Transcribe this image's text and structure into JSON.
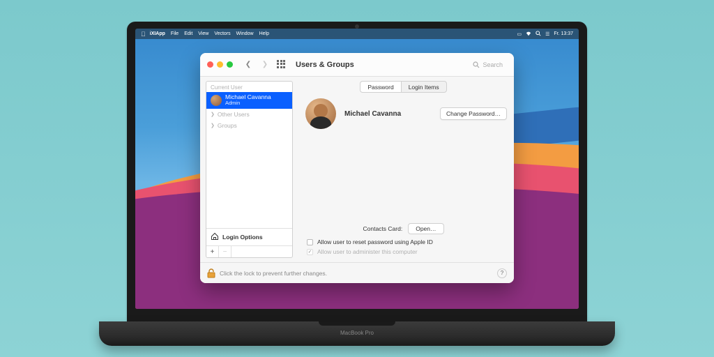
{
  "menubar": {
    "app": "iXIApp",
    "items": [
      "File",
      "Edit",
      "View",
      "Vectors",
      "Window",
      "Help"
    ],
    "clock": "Fr. 13:37"
  },
  "window": {
    "title": "Users & Groups",
    "search_placeholder": "Search",
    "tabs": {
      "password": "Password",
      "login_items": "Login Items"
    }
  },
  "sidebar": {
    "current_user_label": "Current User",
    "user": {
      "name": "Michael Cavanna",
      "role": "Admin"
    },
    "other_users": "Other Users",
    "groups": "Groups",
    "login_options": "Login Options"
  },
  "main": {
    "user_name": "Michael Cavanna",
    "change_password": "Change Password…",
    "contacts_card_label": "Contacts Card:",
    "open": "Open…",
    "allow_reset": "Allow user to reset password using Apple ID",
    "allow_admin": "Allow user to administer this computer"
  },
  "footer": {
    "lock_text": "Click the lock to prevent further changes.",
    "help": "?"
  },
  "laptop": {
    "label": "MacBook Pro"
  }
}
